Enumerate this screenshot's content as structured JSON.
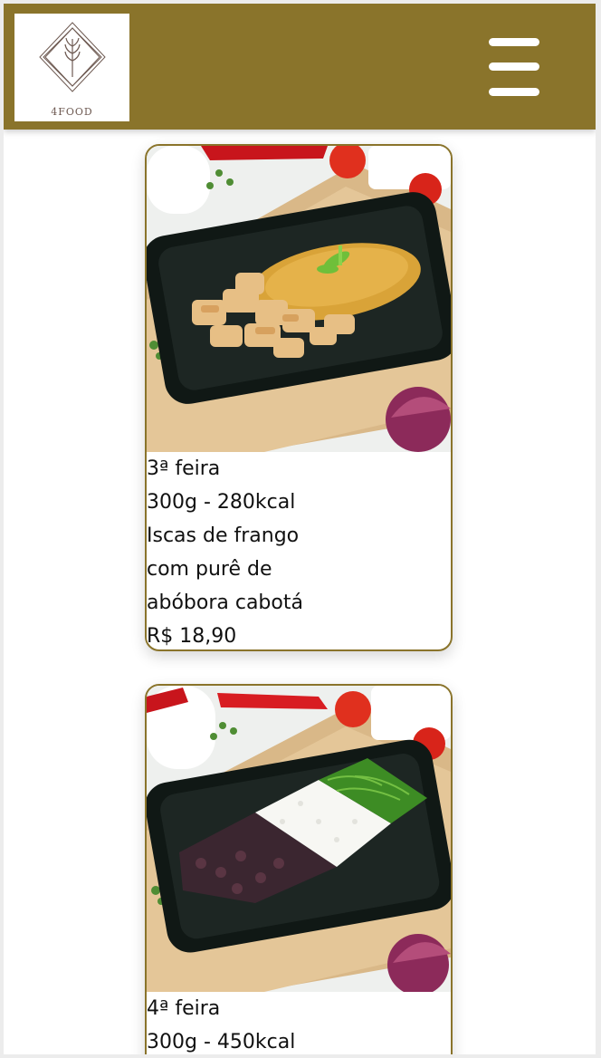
{
  "header": {
    "logo_text": "4FOOD",
    "logo_icon": "wheat-diamond-logo-icon",
    "menu_icon": "hamburger-menu-icon",
    "background_color": "#8a742b"
  },
  "products": [
    {
      "image_alt": "Iscas de frango com purê de abóbora cabotá",
      "day": "3ª feira",
      "portion": "300g - 280kcal",
      "description": "Iscas de frango com purê de abóbora cabotá",
      "price": "R$ 18,90"
    },
    {
      "image_alt": "Feijão, arroz e couve",
      "day": "4ª feira",
      "portion": "300g - 450kcal"
    }
  ],
  "accent_color": "#8a742b"
}
